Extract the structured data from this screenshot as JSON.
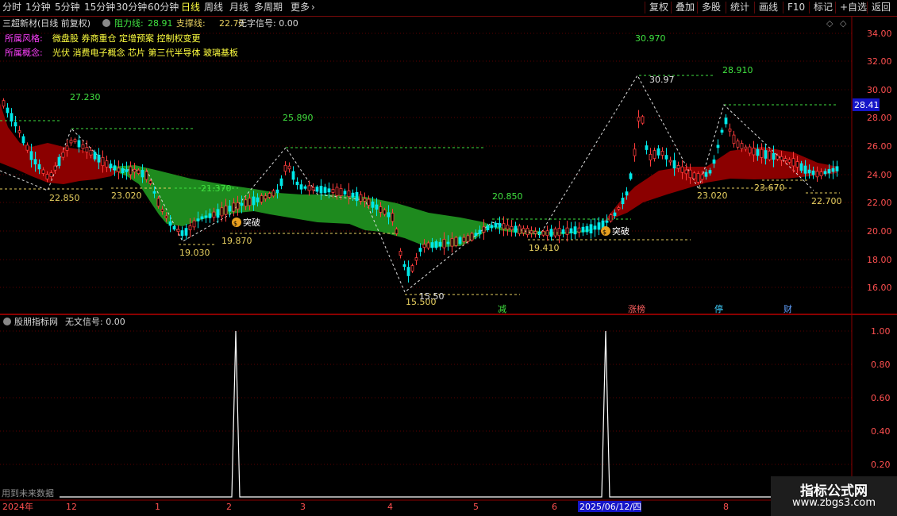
{
  "toolbar": {
    "periods": [
      "分时",
      "1分钟",
      "5分钟",
      "15分钟",
      "30分钟",
      "60分钟",
      "日线",
      "周线",
      "月线",
      "多周期",
      "更多"
    ],
    "active_period": "日线",
    "right_buttons": [
      "复权",
      "叠加",
      "多股",
      "统计",
      "画线",
      "F10",
      "标记",
      "+自选",
      "返回"
    ]
  },
  "header": {
    "stock_name": "三超新材(日线 前复权)",
    "resistance_label": "阻力线:",
    "resistance_value": "28.91",
    "support_label": "支撑线:",
    "support_value": "22.70",
    "signal_text": "无字信号: 0.00"
  },
  "info": {
    "style_label": "所属风格:",
    "style_values": "微盘股 券商重仓 定增预案 控制权变更",
    "concept_label": "所属概念:",
    "concept_values": "光伏 消费电子概念 芯片 第三代半导体 玻璃基板"
  },
  "price_axis": {
    "ticks": [
      "34.00",
      "32.00",
      "30.00",
      "28.00",
      "26.00",
      "24.00",
      "22.00",
      "20.00",
      "18.00",
      "16.00"
    ],
    "current_price": "28.41"
  },
  "annotations": {
    "peak_labels": [
      "27.230",
      "25.890",
      "21.370",
      "20.850",
      "30.970",
      "28.910"
    ],
    "trough_labels": [
      "22.850",
      "23.020",
      "19.030",
      "19.870",
      "15.500",
      "19.410",
      "23.020",
      "23.670",
      "22.700"
    ],
    "inline_labels": [
      "30.97",
      "15.50"
    ],
    "breakout_text": "突破",
    "event_markers": [
      "减",
      "涨榜",
      "停",
      "财"
    ]
  },
  "indicator": {
    "title": "股朋指标网",
    "signal_text": "无文信号: 0.00",
    "ticks": [
      "1.00",
      "0.80",
      "0.60",
      "0.40",
      "0.20"
    ],
    "footer_note": "用到未来数据"
  },
  "time_axis": {
    "labels": [
      "2024年",
      "12",
      "1",
      "2",
      "3",
      "4",
      "5",
      "6",
      "2025/06/12/四",
      "8"
    ]
  },
  "watermark": {
    "line1": "指标公式网",
    "line2": "www.zbgs3.com"
  },
  "colors": {
    "up": "#ff3c3c",
    "down": "#00ffff",
    "fill_up": "#8b0000",
    "fill_down": "#1e8a1e",
    "label": "#e8d060",
    "peak_label": "#40e040",
    "grid": "#6e0000"
  }
}
